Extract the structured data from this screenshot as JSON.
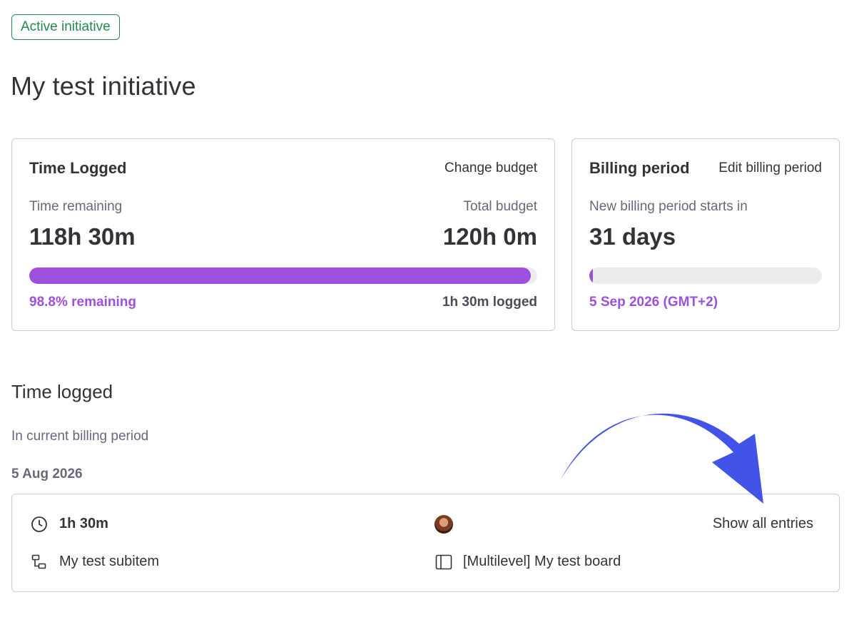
{
  "status": {
    "label": "Active initiative",
    "color": "#258750"
  },
  "title": "My test initiative",
  "time_card": {
    "title": "Time Logged",
    "change_budget_label": "Change budget",
    "remaining_label": "Time remaining",
    "remaining_value": "118h 30m",
    "total_label": "Total budget",
    "total_value": "120h 0m",
    "progress_fraction": 0.988,
    "remaining_pct_label": "98.8% remaining",
    "logged_label": "1h 30m logged",
    "accent": "#9d50dd"
  },
  "billing_card": {
    "title": "Billing period",
    "edit_label": "Edit billing period",
    "starts_label": "New billing period starts in",
    "days_value": "31 days",
    "progress_fraction": 0.01,
    "date_label": "5 Sep 2026 (GMT+2)"
  },
  "logged_section": {
    "title": "Time logged",
    "subtitle": "In current billing period",
    "date": "5 Aug 2026",
    "entry": {
      "duration": "1h 30m",
      "duration_icon": "clock-icon",
      "avatar_icon": "user-avatar",
      "show_all_label": "Show all entries",
      "subitem": "My test subitem",
      "subitem_icon": "subitem-icon",
      "board": "[Multilevel] My test board",
      "board_icon": "board-icon"
    }
  },
  "annotation": {
    "arrow_icon": "curved-arrow-icon",
    "color": "#4254e8"
  }
}
